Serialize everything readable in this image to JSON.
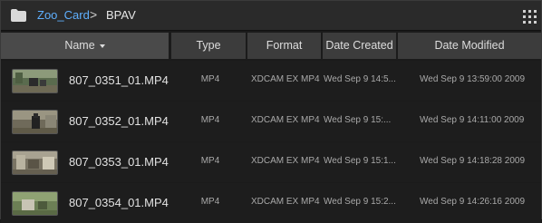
{
  "breadcrumb": {
    "parent": "Zoo_Card",
    "separator": ">",
    "current": "BPAV"
  },
  "columns": [
    "Name",
    "Type",
    "Format",
    "Date Created",
    "Date Modified"
  ],
  "files": [
    {
      "name": "807_0351_01.MP4",
      "type": "MP4",
      "format": "XDCAM EX MP4",
      "created": "Wed Sep  9 14:5...",
      "modified": "Wed Sep  9 13:59:00 2009"
    },
    {
      "name": "807_0352_01.MP4",
      "type": "MP4",
      "format": "XDCAM EX MP4",
      "created": "Wed Sep  9 15:...",
      "modified": "Wed Sep  9 14:11:00 2009"
    },
    {
      "name": "807_0353_01.MP4",
      "type": "MP4",
      "format": "XDCAM EX MP4",
      "created": "Wed Sep  9 15:1...",
      "modified": "Wed Sep  9 14:18:28 2009"
    },
    {
      "name": "807_0354_01.MP4",
      "type": "MP4",
      "format": "XDCAM EX MP4",
      "created": "Wed Sep  9 15:2...",
      "modified": "Wed Sep  9 14:26:16 2009"
    }
  ],
  "colors": {
    "link": "#5fb0ff",
    "header_bg": "#3c3c3c",
    "row_bg": "#1d1d1d"
  },
  "icons": {
    "folder": "folder-icon",
    "grid": "grid-view-icon",
    "sort": "sort-descending-icon"
  }
}
